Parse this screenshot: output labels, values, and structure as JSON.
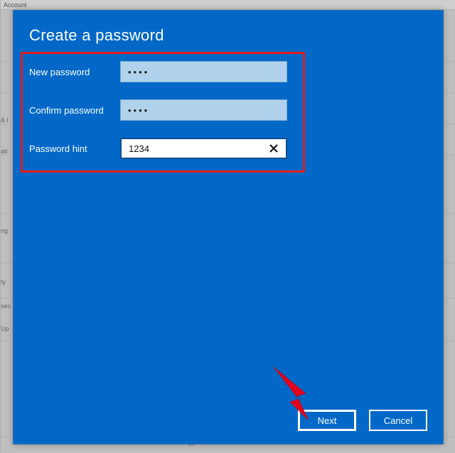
{
  "background": {
    "breadcrumb": "Account",
    "edges": [
      "& i",
      "ati",
      "ng",
      "ty",
      "sec",
      "Up",
      "in"
    ]
  },
  "dialog": {
    "title": "Create a password",
    "rows": {
      "new_pw": {
        "label": "New password",
        "value": "••••"
      },
      "confirm": {
        "label": "Confirm password",
        "value": "••••"
      },
      "hint": {
        "label": "Password hint",
        "value": "1234"
      }
    },
    "buttons": {
      "next": "Next",
      "cancel": "Cancel"
    }
  }
}
